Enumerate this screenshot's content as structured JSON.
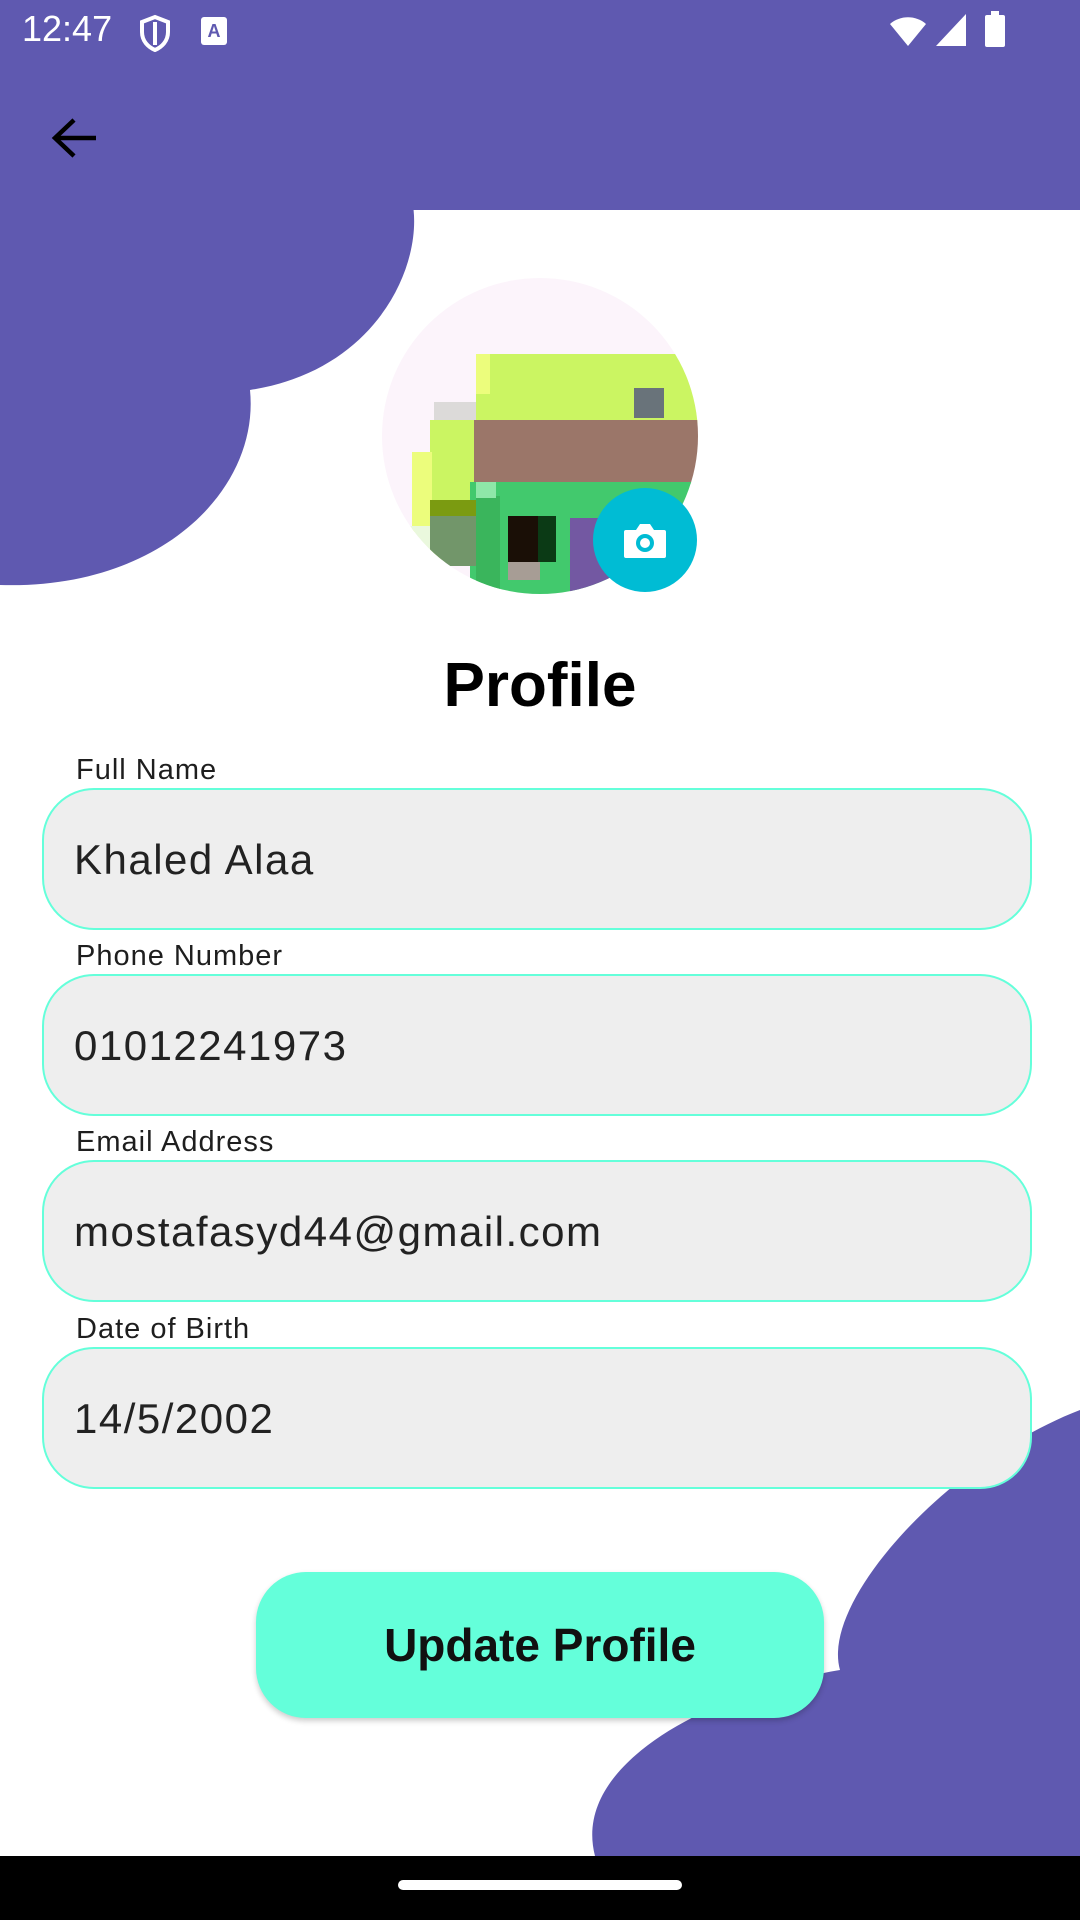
{
  "status_bar": {
    "time": "12:47",
    "icons": [
      "shield-icon",
      "a-icon",
      "wifi-icon",
      "signal-icon",
      "battery-icon"
    ]
  },
  "app_bar": {
    "back_icon": "arrow-back-icon",
    "color": "#5f59b0"
  },
  "profile": {
    "avatar_description_icon": "avatar",
    "camera_icon": "camera-icon",
    "title": "Profile"
  },
  "form": {
    "fields": [
      {
        "label": "Full Name",
        "value": "Khaled Alaa"
      },
      {
        "label": "Phone Number",
        "value": "01012241973"
      },
      {
        "label": "Email Address",
        "value": "mostafasyd44@gmail.com"
      },
      {
        "label": "Date of Birth",
        "value": "14/5/2002"
      }
    ],
    "update_label": "Update Profile"
  },
  "colors": {
    "primary": "#5f59b0",
    "accent": "#64ffda",
    "camera": "#00bcd4",
    "field_bg": "#eeeeee"
  }
}
